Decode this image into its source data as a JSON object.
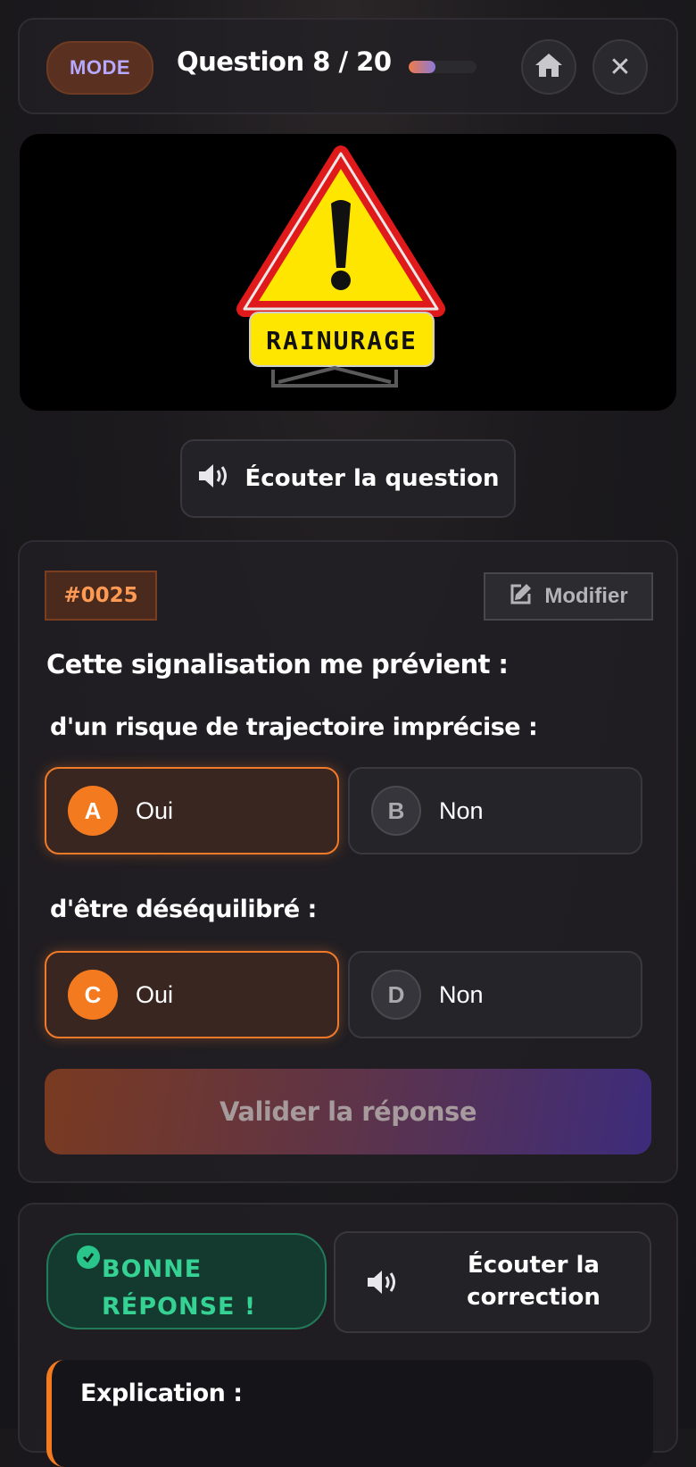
{
  "header": {
    "mode_label": "MODE",
    "question_counter": "Question 8 / 20",
    "progress_fraction": 0.4,
    "home_icon": "home-icon",
    "close_icon": "close-icon",
    "close_glyph": "✕"
  },
  "sign": {
    "label": "RAINURAGE"
  },
  "listen_question": {
    "label": "Écouter la question",
    "icon": "speaker-icon"
  },
  "question": {
    "id": "#0025",
    "edit_label": "Modifier",
    "edit_icon": "edit-icon",
    "text": "Cette signalisation me prévient :",
    "groups": [
      {
        "label": "d'un risque de trajectoire imprécise :",
        "options": [
          {
            "letter": "A",
            "text": "Oui",
            "selected": true
          },
          {
            "letter": "B",
            "text": "Non",
            "selected": false
          }
        ]
      },
      {
        "label": "d'être déséquilibré :",
        "options": [
          {
            "letter": "C",
            "text": "Oui",
            "selected": true
          },
          {
            "letter": "D",
            "text": "Non",
            "selected": false
          }
        ]
      }
    ],
    "validate_label": "Valider la réponse"
  },
  "feedback": {
    "result_line1": "BONNE",
    "result_line2": "RÉPONSE !",
    "listen_line1": "Écouter la",
    "listen_line2": "correction",
    "explanation_title": "Explication :"
  },
  "colors": {
    "accent": "#f47a1f",
    "success": "#35d294",
    "background": "#1c1a1d"
  }
}
